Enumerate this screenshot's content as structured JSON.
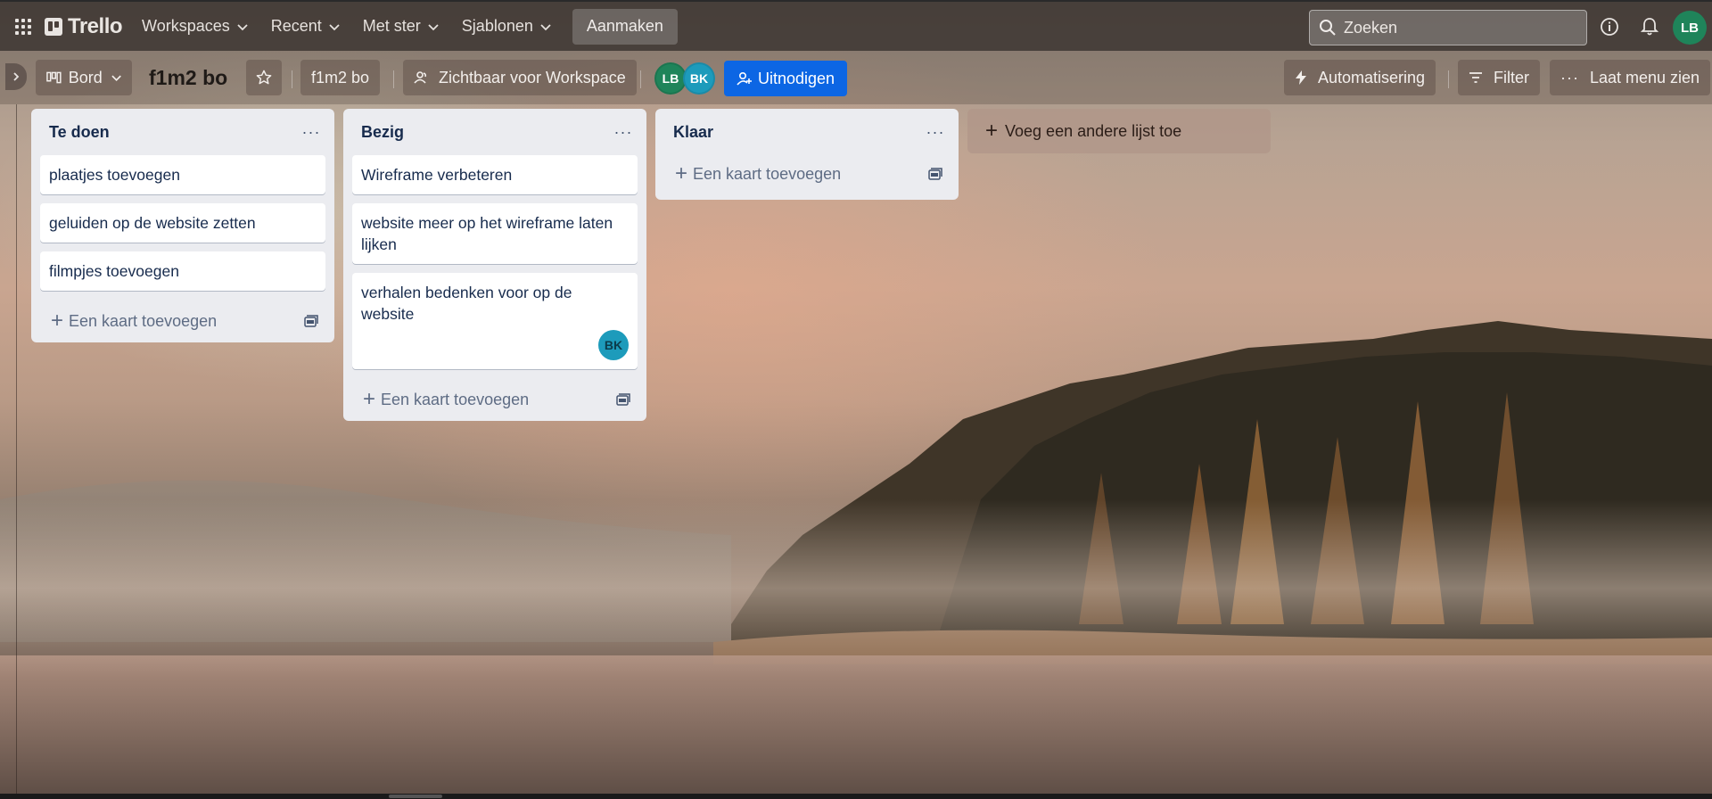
{
  "header": {
    "logo_text": "Trello",
    "nav": [
      {
        "label": "Workspaces"
      },
      {
        "label": "Recent"
      },
      {
        "label": "Met ster"
      },
      {
        "label": "Sjablonen"
      }
    ],
    "create_label": "Aanmaken",
    "search_placeholder": "Zoeken",
    "user_initials": "LB",
    "user_color": "#1f845a"
  },
  "board": {
    "view_label": "Bord",
    "title": "f1m2 bo",
    "workspace_label": "f1m2 bo",
    "visibility_label": "Zichtbaar voor Workspace",
    "members": [
      {
        "initials": "LB",
        "color": "#1f845a"
      },
      {
        "initials": "BK",
        "color": "#1d9bbb"
      }
    ],
    "invite_label": "Uitnodigen",
    "automation_label": "Automatisering",
    "filter_label": "Filter",
    "menu_label": "Laat menu zien"
  },
  "lists": [
    {
      "title": "Te doen",
      "cards": [
        {
          "text": "plaatjes toevoegen"
        },
        {
          "text": "geluiden op de website zetten"
        },
        {
          "text": "filmpjes toevoegen"
        }
      ],
      "add_card_label": "Een kaart toevoegen"
    },
    {
      "title": "Bezig",
      "cards": [
        {
          "text": "Wireframe verbeteren"
        },
        {
          "text": "website meer op het wireframe laten lijken"
        },
        {
          "text": "verhalen bedenken voor op de website",
          "member": "BK"
        }
      ],
      "add_card_label": "Een kaart toevoegen"
    },
    {
      "title": "Klaar",
      "cards": [],
      "add_card_label": "Een kaart toevoegen"
    }
  ],
  "add_list_label": "Voeg een andere lijst toe",
  "colors": {
    "accent": "#0c66e4",
    "list_bg": "#ebecf0"
  }
}
